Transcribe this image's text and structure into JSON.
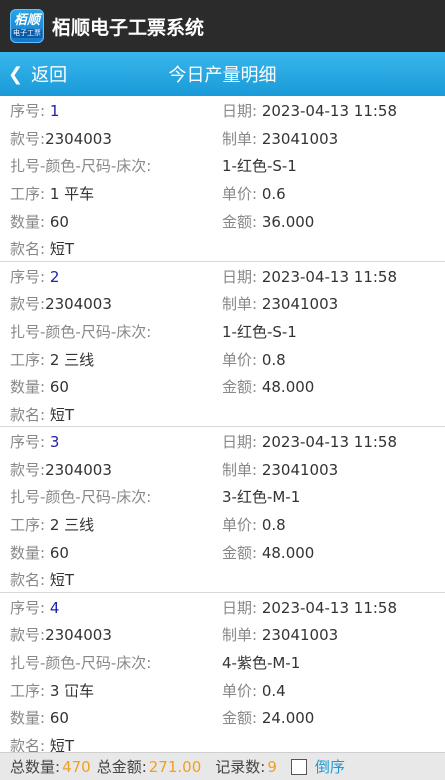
{
  "app": {
    "logo_line1": "栢顺",
    "logo_line2": "电子工票",
    "title": "栢顺电子工票系统"
  },
  "nav": {
    "back_label": "返回",
    "title": "今日产量明细"
  },
  "labels": {
    "seq": "序号:",
    "date": "日期:",
    "style_no": "款号:",
    "order_no": "制单:",
    "bundle": "扎号-颜色-尺码-床次:",
    "process": "工序:",
    "unit_price": "单价:",
    "quantity": "数量:",
    "amount": "金额:",
    "style_name": "款名:"
  },
  "records": [
    {
      "seq": "1",
      "date": "2023-04-13 11:58",
      "style_no": "2304003",
      "order_no": "23041003",
      "bundle": "1-红色-S-1",
      "process": "1 平车",
      "unit_price": "0.6",
      "quantity": "60",
      "amount": "36.000",
      "style_name": "短T"
    },
    {
      "seq": "2",
      "date": "2023-04-13 11:58",
      "style_no": "2304003",
      "order_no": "23041003",
      "bundle": "1-红色-S-1",
      "process": "2 三线",
      "unit_price": "0.8",
      "quantity": "60",
      "amount": "48.000",
      "style_name": "短T"
    },
    {
      "seq": "3",
      "date": "2023-04-13 11:58",
      "style_no": "2304003",
      "order_no": "23041003",
      "bundle": "3-红色-M-1",
      "process": "2 三线",
      "unit_price": "0.8",
      "quantity": "60",
      "amount": "48.000",
      "style_name": "短T"
    },
    {
      "seq": "4",
      "date": "2023-04-13 11:58",
      "style_no": "2304003",
      "order_no": "23041003",
      "bundle": "4-紫色-M-1",
      "process": "3 冚车",
      "unit_price": "0.4",
      "quantity": "60",
      "amount": "24.000",
      "style_name": "短T"
    }
  ],
  "footer": {
    "total_qty_label": "总数量:",
    "total_qty": "470",
    "total_amount_label": "总金额:",
    "total_amount": "271.00",
    "record_count_label": "记录数:",
    "record_count": "9",
    "reverse_label": "倒序"
  }
}
